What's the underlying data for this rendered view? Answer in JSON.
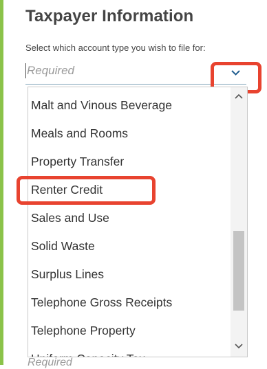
{
  "section": {
    "title": "Taxpayer Information",
    "label": "Select which account type you wish to file for:"
  },
  "select": {
    "placeholder": "Required"
  },
  "dropdown": {
    "items": [
      "Malt and Vinous Beverage",
      "Meals and Rooms",
      "Property Transfer",
      "Renter Credit",
      "Sales and Use",
      "Solid Waste",
      "Surplus Lines",
      "Telephone Gross Receipts",
      "Telephone Property",
      "Uniform Capacity Tax"
    ],
    "highlighted_item": "Renter Credit"
  },
  "below_field": {
    "placeholder": "Required"
  },
  "colors": {
    "accent": "#8bc34a",
    "highlight": "#e8432f"
  }
}
